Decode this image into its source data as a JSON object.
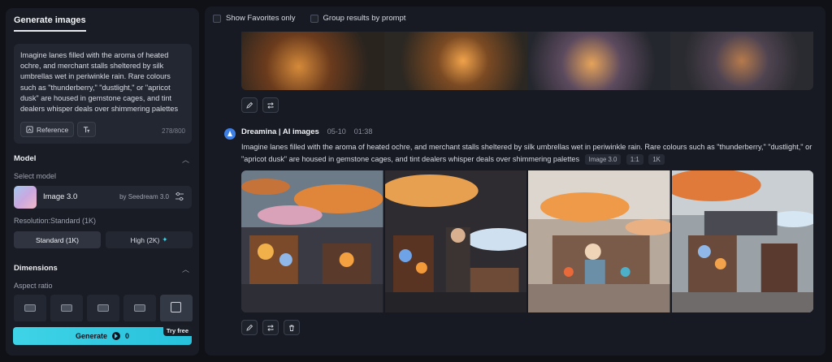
{
  "left": {
    "tab": "Generate images",
    "prompt": "Imagine lanes filled with the aroma of heated ochre, and merchant stalls sheltered by silk umbrellas wet in periwinkle rain. Rare colours such as \"thunderberry,\" \"dustlight,\" or \"apricot dusk\" are housed in gemstone cages, and tint dealers whisper deals over shimmering palettes",
    "reference_label": "Reference",
    "char_count": "278/800",
    "model_section": "Model",
    "select_model_label": "Select model",
    "model_name": "Image 3.0",
    "model_by": "by Seedream 3.0",
    "resolution_label": "Resolution:Standard (1K)",
    "res_standard": "Standard (1K)",
    "res_high": "High (2K)",
    "dimensions_section": "Dimensions",
    "aspect_ratio_label": "Aspect ratio",
    "aspect_options": [
      "21:9",
      "16:9",
      "3:2",
      "4:3",
      "1:1"
    ],
    "generate_label": "Generate",
    "generate_cost": "0",
    "try_free": "Try free",
    "accent": "#3fd3e6"
  },
  "main": {
    "filters": {
      "favorites": "Show Favorites only",
      "group": "Group results by prompt"
    },
    "entry": {
      "author": "Dreamina | AI images",
      "date": "05-10",
      "time": "01:38",
      "prompt": "Imagine lanes filled with the aroma of heated ochre, and merchant stalls sheltered by silk umbrellas wet in periwinkle rain. Rare colours such as \"thunderberry,\" \"dustlight,\" or \"apricot dusk\" are housed in gemstone cages, and tint dealers whisper deals over shimmering palettes",
      "tags": [
        "Image 3.0",
        "1:1",
        "1K"
      ]
    }
  }
}
